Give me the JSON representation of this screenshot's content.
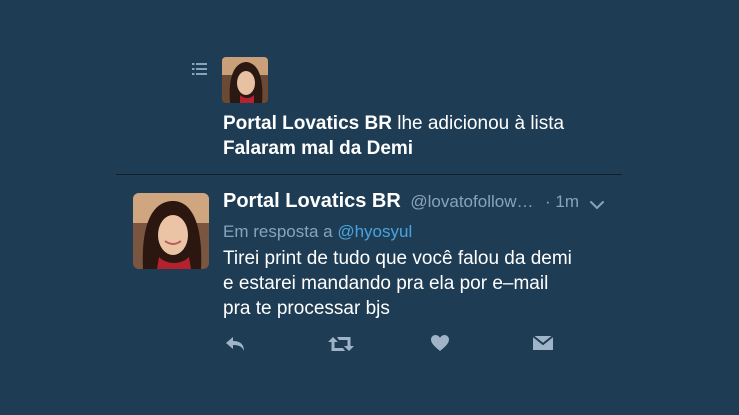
{
  "notification": {
    "actor": "Portal Lovatics BR",
    "action_text": "lhe adicionou à lista",
    "list_name": "Falaram mal da Demi"
  },
  "tweet": {
    "display_name": "Portal Lovatics BR",
    "handle": "@lovatofollow…",
    "time": "· 1m",
    "reply_prefix": "Em resposta a",
    "reply_to": "@hyosyul",
    "text_lines": [
      "Tirei print de tudo que você falou da demi",
      "e estarei mandando pra ela por e–mail",
      "pra te processar bjs"
    ]
  },
  "icons": {
    "list": "list-icon",
    "caret": "chevron-down-icon",
    "reply": "reply-icon",
    "retweet": "retweet-icon",
    "like": "heart-icon",
    "dm": "envelope-icon"
  },
  "colors": {
    "background": "#1e3d55",
    "text_primary": "#ffffff",
    "text_secondary": "#8ba3b8",
    "mention": "#4aa3df",
    "action_icon": "#9fb4c6"
  }
}
